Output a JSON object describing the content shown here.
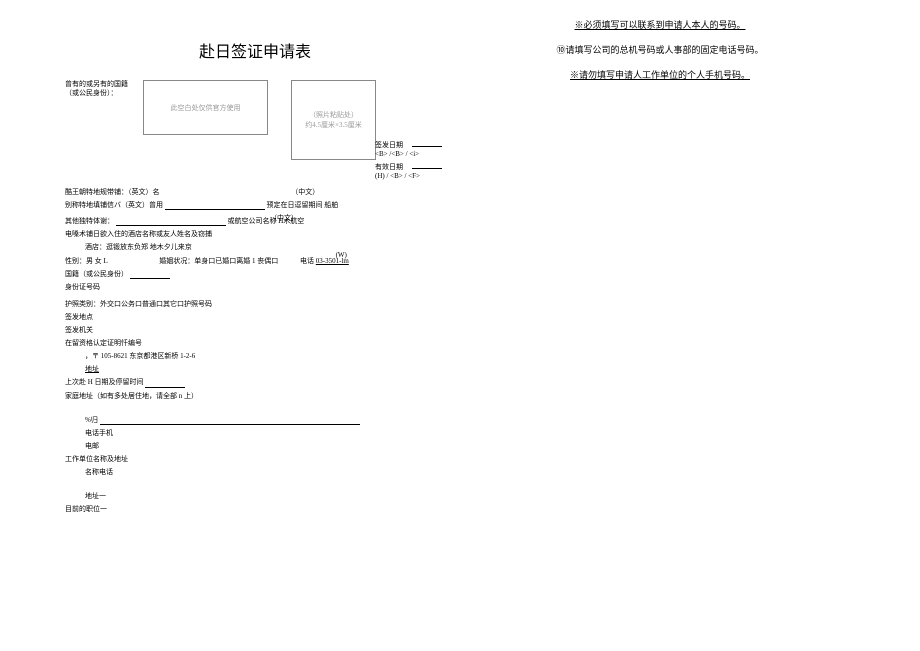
{
  "title": "赴日签证申请表",
  "right_notes": {
    "note1": "※必须填写可以联系到申请人本人的号码。",
    "note2": "⑩请填写公司的总机号码或人事部的固定电话号码。",
    "note3": "※请勿填写申请人工作单位的个人手机号码。"
  },
  "nationality_block": "曾有的或另有的国籍（或公民身份）：",
  "official_box": "此空白处仅供官方使用",
  "photo_box": {
    "line1": "（照片粘贴处）",
    "line2": "约4.5厘米×3.5厘米"
  },
  "dates": {
    "issue_label": "签发日期",
    "expiry_label": "有效日期",
    "format1": "<B> /<B> / <i>",
    "format2": "(H) / <B> / <F>"
  },
  "fields": {
    "name_section": "酷王朝特地规带铺：（英文）名",
    "cn_note": "（中文）",
    "prev_name": "别称特地填铺信バ（英文）曾用",
    "prev_name_note": "预定在日逗留期间  船舶",
    "other_name": "其他独特体谢：",
    "airline": "或航空公司名称 H木航空",
    "hotel_section": "电嗓术铺日欲入住的酒店名称或友人姓名及窃捕",
    "hotel_sub": "酒店：逛锻放东负郑 地木夕儿来京",
    "gender": "性别：男 女 L",
    "marital": "婚姻状况：单身口已婚口离婚 1 丧偶口",
    "phone_label": "电话",
    "phone_value": "03-3501-lm",
    "phone_note": "(W)",
    "nationality": "国籍（或公民身份）",
    "id_number": "身份证号码",
    "passport_type": "护照类别：外交口公务口普通口其它口护照号码",
    "issue_place": "签发地点",
    "issue_auth": "签发机关",
    "cert_no": "在留资格认定证明忏编号",
    "address_prefix": "，〒 105-8621 东京都港区新桥 1-2-6",
    "address_label": "地址",
    "last_visit": "上次赴 H 日期及停留时间",
    "home_addr": "家庭地址（如有多处居住地，请全部 n 上）",
    "phone_mobile": "电话手机",
    "email": "电邮",
    "work_unit": "工作单位名称及地址",
    "name_phone": "名称电话",
    "address2": "地址一",
    "position": "目前的职位一",
    "percent": "%归"
  }
}
